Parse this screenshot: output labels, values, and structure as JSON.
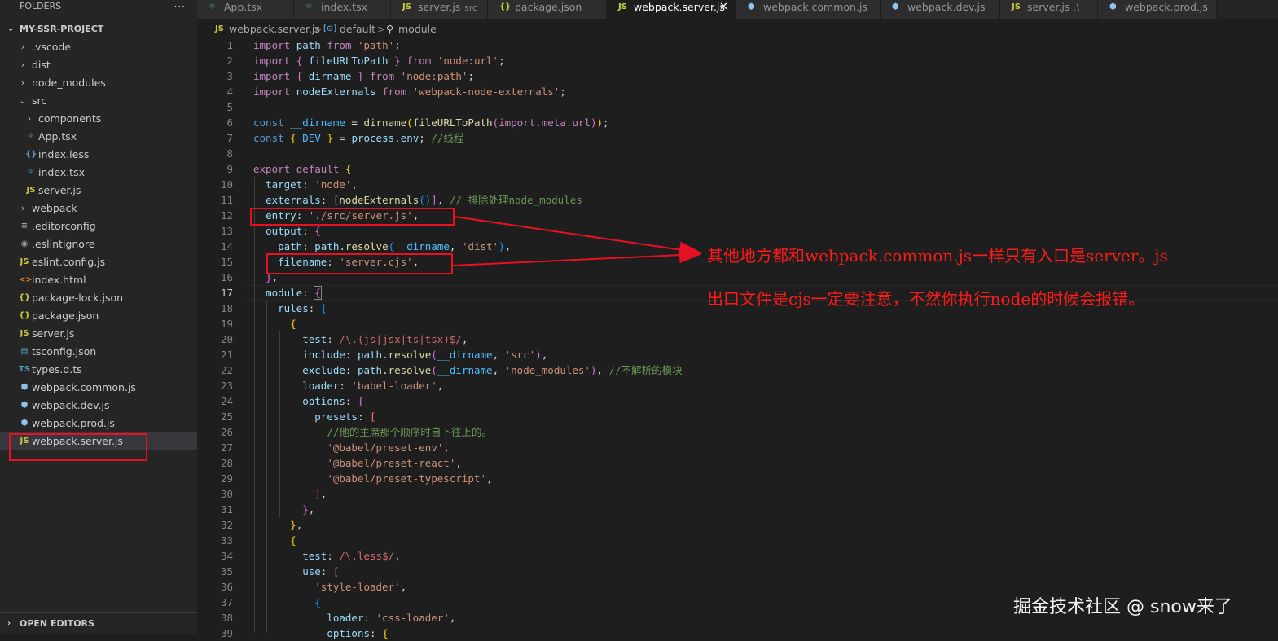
{
  "explorer": {
    "header": "FOLDERS",
    "more": "···",
    "project": "MY-SSR-PROJECT",
    "items": [
      {
        "label": ".vscode",
        "type": "folder"
      },
      {
        "label": "dist",
        "type": "folder"
      },
      {
        "label": "node_modules",
        "type": "folder"
      },
      {
        "label": "src",
        "type": "folder-open"
      },
      {
        "label": "components",
        "type": "folder"
      },
      {
        "label": "App.tsx",
        "icon": "react-icon"
      },
      {
        "label": "index.less",
        "icon": "less-icon",
        "glyph": "{}"
      },
      {
        "label": "index.tsx",
        "icon": "react-icon"
      },
      {
        "label": "server.js",
        "icon": "js-icon",
        "glyph": "JS"
      },
      {
        "label": "webpack",
        "type": "folder"
      },
      {
        "label": ".editorconfig",
        "icon": "config-icon"
      },
      {
        "label": ".eslintignore",
        "icon": "eslint-icon"
      },
      {
        "label": "eslint.config.js",
        "icon": "js-icon",
        "glyph": "JS"
      },
      {
        "label": "index.html",
        "icon": "html-icon",
        "glyph": "<>"
      },
      {
        "label": "package-lock.json",
        "icon": "json-icon",
        "glyph": "{}"
      },
      {
        "label": "package.json",
        "icon": "json-icon",
        "glyph": "{}"
      },
      {
        "label": "server.js",
        "icon": "js-icon",
        "glyph": "JS"
      },
      {
        "label": "tsconfig.json",
        "icon": "ts-icon"
      },
      {
        "label": "types.d.ts",
        "icon": "ts-icon",
        "glyph": "TS"
      },
      {
        "label": "webpack.common.js",
        "icon": "webpack-icon"
      },
      {
        "label": "webpack.dev.js",
        "icon": "webpack-icon"
      },
      {
        "label": "webpack.prod.js",
        "icon": "webpack-icon"
      },
      {
        "label": "webpack.server.js",
        "icon": "js-icon",
        "glyph": "JS",
        "selected": true
      }
    ],
    "open_editors": "OPEN EDITORS"
  },
  "tabs": [
    {
      "label": "App.tsx",
      "icon": "react-icon"
    },
    {
      "label": "index.tsx",
      "icon": "react-icon"
    },
    {
      "label": "server.js",
      "icon": "js-icon",
      "glyph": "JS",
      "desc": "src"
    },
    {
      "label": "package.json",
      "icon": "json-icon",
      "glyph": "{}"
    },
    {
      "label": "webpack.server.js",
      "icon": "js-icon",
      "glyph": "JS",
      "active": true
    },
    {
      "label": "webpack.common.js",
      "icon": "webpack-icon"
    },
    {
      "label": "webpack.dev.js",
      "icon": "webpack-icon"
    },
    {
      "label": "server.js",
      "icon": "js-icon",
      "glyph": "JS",
      "desc": ".\\"
    },
    {
      "label": "webpack.prod.js",
      "icon": "webpack-icon"
    }
  ],
  "breadcrumb": {
    "file": "webpack.server.js",
    "glyph": "JS",
    "sep": ">",
    "symbol1": "default",
    "symbol1_glyph": "[⊙]",
    "symbol2": "module",
    "symbol2_glyph": "⚲"
  },
  "editor": {
    "current_line": 17,
    "line_numbers": [
      "1",
      "2",
      "3",
      "4",
      "5",
      "6",
      "7",
      "8",
      "9",
      "10",
      "11",
      "12",
      "13",
      "14",
      "15",
      "16",
      "17",
      "18",
      "19",
      "20",
      "21",
      "22",
      "23",
      "24",
      "25",
      "26",
      "27",
      "28",
      "29",
      "30",
      "31",
      "32",
      "33",
      "34",
      "35",
      "36",
      "37",
      "38",
      "39"
    ],
    "t": {
      "import": "import",
      "from": "from",
      "export": "export",
      "default": "default",
      "const": "const",
      "path": "path",
      "fileURLToPath": "fileURLToPath",
      "dirname": "dirname",
      "nodeExternals": "nodeExternals",
      "__dirname": "__dirname",
      "import_meta_url": "import.meta.url",
      "DEV": "DEV",
      "process": "process",
      "env": "env",
      "resolve": "resolve",
      "target": "target",
      "externals": "externals",
      "entry": "entry",
      "output": "output",
      "filename": "filename",
      "module": "module",
      "rules": "rules",
      "test": "test",
      "include": "include",
      "exclude": "exclude",
      "loader": "loader",
      "options": "options",
      "presets": "presets",
      "use": "use",
      "s_path": "'path'",
      "s_url": "'node:url'",
      "s_nodepath": "'node:path'",
      "s_wne": "'webpack-node-externals'",
      "s_node": "'node'",
      "s_entry": "'./src/server.js'",
      "s_dist": "'dist'",
      "s_filename": "'server.cjs'",
      "s_src": "'src'",
      "s_nm": "'node_modules'",
      "s_babel": "'babel-loader'",
      "s_env": "'@babel/preset-env'",
      "s_react": "'@babel/preset-react'",
      "s_ts": "'@babel/preset-typescript'",
      "s_style": "'style-loader'",
      "s_css": "'css-loader'",
      "c_thread": "//线程",
      "c_exclude": "// 排除处理node_modules",
      "c_noparse": "//不解析的模块",
      "c_order": "//他的主席那个顺序时自下往上的。",
      "rx1": "/\\.(js|jsx|ts|tsx)$/",
      "rx2": "/\\.less$/"
    }
  },
  "annotations": {
    "line1": "其他地方都和webpack.common.js一样只有入口是server。js",
    "line2": "出口文件是cjs一定要注意，不然你执行node的时候会报错。",
    "color": "#ff1a1a"
  },
  "watermark": "掘金技术社区 @ snow来了"
}
